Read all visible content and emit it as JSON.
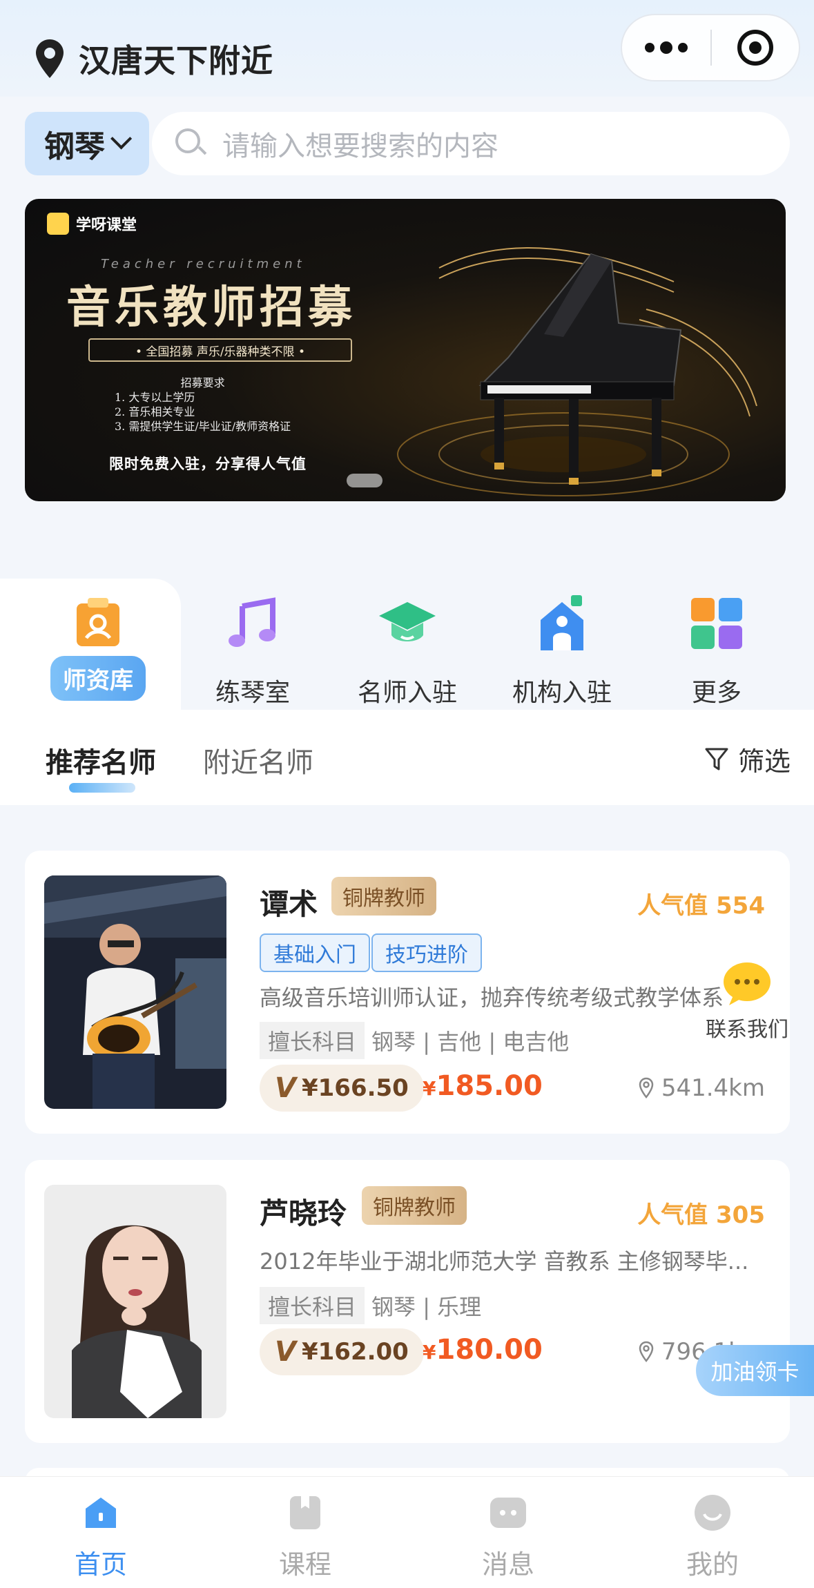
{
  "header": {
    "location": "汉唐天下附近"
  },
  "search": {
    "category": "钢琴",
    "placeholder": "请输入想要搜索的内容"
  },
  "banner": {
    "logo_text": "学呀课堂",
    "subtitle_en": "Teacher recruitment",
    "title": "音乐教师招募",
    "pill": "• 全国招募 声乐/乐器种类不限 •",
    "requirements": [
      "招募要求",
      "1. 大专以上学历",
      "2. 音乐相关专业",
      "3. 需提供学生证/毕业证/教师资格证"
    ],
    "footer": "限时免费入驻，分享得人气值"
  },
  "quick": [
    {
      "label": "师资库",
      "icon": "teacher-library-icon",
      "active": true
    },
    {
      "label": "练琴室",
      "icon": "music-note-icon",
      "active": false
    },
    {
      "label": "名师入驻",
      "icon": "graduation-cap-icon",
      "active": false
    },
    {
      "label": "机构入驻",
      "icon": "institution-icon",
      "active": false
    },
    {
      "label": "更多",
      "icon": "grid-more-icon",
      "active": false
    }
  ],
  "tabs": {
    "recommended": "推荐名师",
    "nearby": "附近名师",
    "filter": "筛选"
  },
  "teachers": [
    {
      "name": "谭术",
      "badge": "铜牌教师",
      "popularity": "人气值 554",
      "tags": [
        "基础入门",
        "技巧进阶"
      ],
      "desc": "高级音乐培训师认证，抛弃传统考级式教学体系",
      "skill_label": "擅长科目",
      "skills": "钢琴 | 吉他 | 电吉他",
      "vip_price": "¥166.50",
      "price_symbol": "¥",
      "price": "185.00",
      "distance": "541.4km"
    },
    {
      "name": "芦晓玲",
      "badge": "铜牌教师",
      "popularity": "人气值 305",
      "desc": "2012年毕业于湖北师范大学 音教系 主修钢琴毕...",
      "skill_label": "擅长科目",
      "skills": "钢琴 | 乐理",
      "vip_price": "¥162.00",
      "price_symbol": "¥",
      "price": "180.00",
      "distance": "796.1km"
    }
  ],
  "contact": {
    "label": "联系我们"
  },
  "fab": {
    "label": "加油领卡"
  },
  "tabbar": [
    {
      "label": "首页",
      "active": true
    },
    {
      "label": "课程",
      "active": false
    },
    {
      "label": "消息",
      "active": false
    },
    {
      "label": "我的",
      "active": false
    }
  ],
  "colors": {
    "accent_blue": "#3d8ff0",
    "price_orange": "#f15a22",
    "popularity": "#f3a53a",
    "badge_bronze": "#d6b386"
  }
}
